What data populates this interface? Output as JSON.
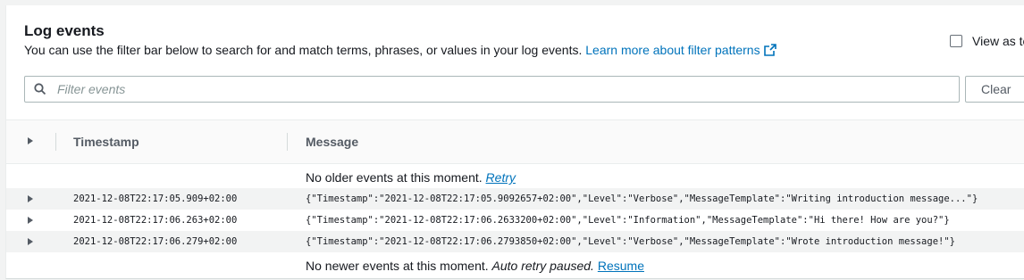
{
  "header": {
    "title": "Log events",
    "description": "You can use the filter bar below to search for and match terms, phrases, or values in your log events.",
    "learn_more": "Learn more about filter patterns",
    "view_as_text": "View as te"
  },
  "search": {
    "placeholder": "Filter events",
    "value": ""
  },
  "clear_label": "Clear",
  "columns": {
    "timestamp": "Timestamp",
    "message": "Message"
  },
  "top_notice": {
    "text": "No older events at this moment.",
    "link": "Retry"
  },
  "rows": [
    {
      "timestamp": "2021-12-08T22:17:05.909+02:00",
      "message": "{\"Timestamp\":\"2021-12-08T22:17:05.9092657+02:00\",\"Level\":\"Verbose\",\"MessageTemplate\":\"Writing introduction message...\"}"
    },
    {
      "timestamp": "2021-12-08T22:17:06.263+02:00",
      "message": "{\"Timestamp\":\"2021-12-08T22:17:06.2633200+02:00\",\"Level\":\"Information\",\"MessageTemplate\":\"Hi there! How are you?\"}"
    },
    {
      "timestamp": "2021-12-08T22:17:06.279+02:00",
      "message": "{\"Timestamp\":\"2021-12-08T22:17:06.2793850+02:00\",\"Level\":\"Verbose\",\"MessageTemplate\":\"Wrote introduction message!\"}"
    }
  ],
  "bottom_notice": {
    "text": "No newer events at this moment.",
    "status": "Auto retry paused.",
    "link": "Resume"
  },
  "colors": {
    "link": "#0073bb",
    "text": "#16191f",
    "alt_row": "#f2f3f3"
  }
}
